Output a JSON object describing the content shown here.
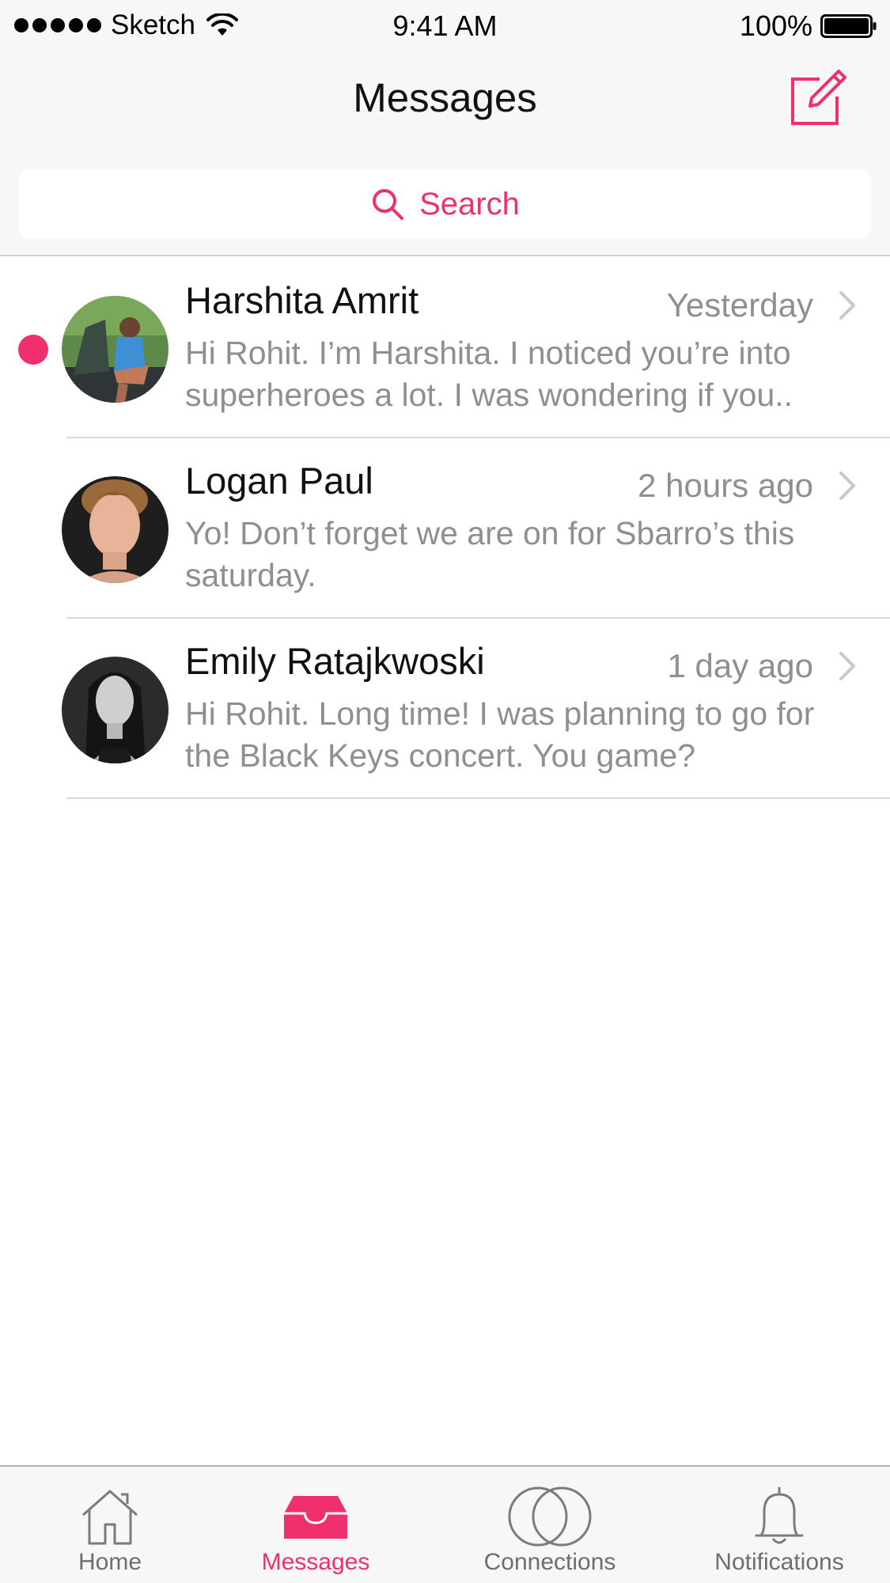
{
  "status_bar": {
    "carrier": "Sketch",
    "time": "9:41 AM",
    "battery": "100%"
  },
  "header": {
    "title": "Messages",
    "compose_icon": "compose-icon"
  },
  "search": {
    "placeholder": "Search",
    "icon": "search-icon"
  },
  "colors": {
    "accent": "#f0306d",
    "secondary_text": "#8e8e93",
    "bar_background": "#f7f7f7"
  },
  "messages": [
    {
      "name": "Harshita Amrit",
      "time": "Yesterday",
      "preview": "Hi Rohit. I’m Harshita. I noticed you’re into superheroes a lot. I was wondering if you..",
      "unread": true
    },
    {
      "name": "Logan Paul",
      "time": "2 hours ago",
      "preview": "Yo! Don’t forget we are on for Sbarro’s this saturday.",
      "unread": false
    },
    {
      "name": "Emily Ratajkwoski",
      "time": "1 day ago",
      "preview": "Hi Rohit. Long time! I was planning to go for the Black Keys concert. You game?",
      "unread": false
    }
  ],
  "tabs": [
    {
      "label": "Home",
      "icon": "home-icon",
      "active": false
    },
    {
      "label": "Messages",
      "icon": "inbox-icon",
      "active": true
    },
    {
      "label": "Connections",
      "icon": "connections-icon",
      "active": false
    },
    {
      "label": "Notifications",
      "icon": "bell-icon",
      "active": false
    }
  ]
}
